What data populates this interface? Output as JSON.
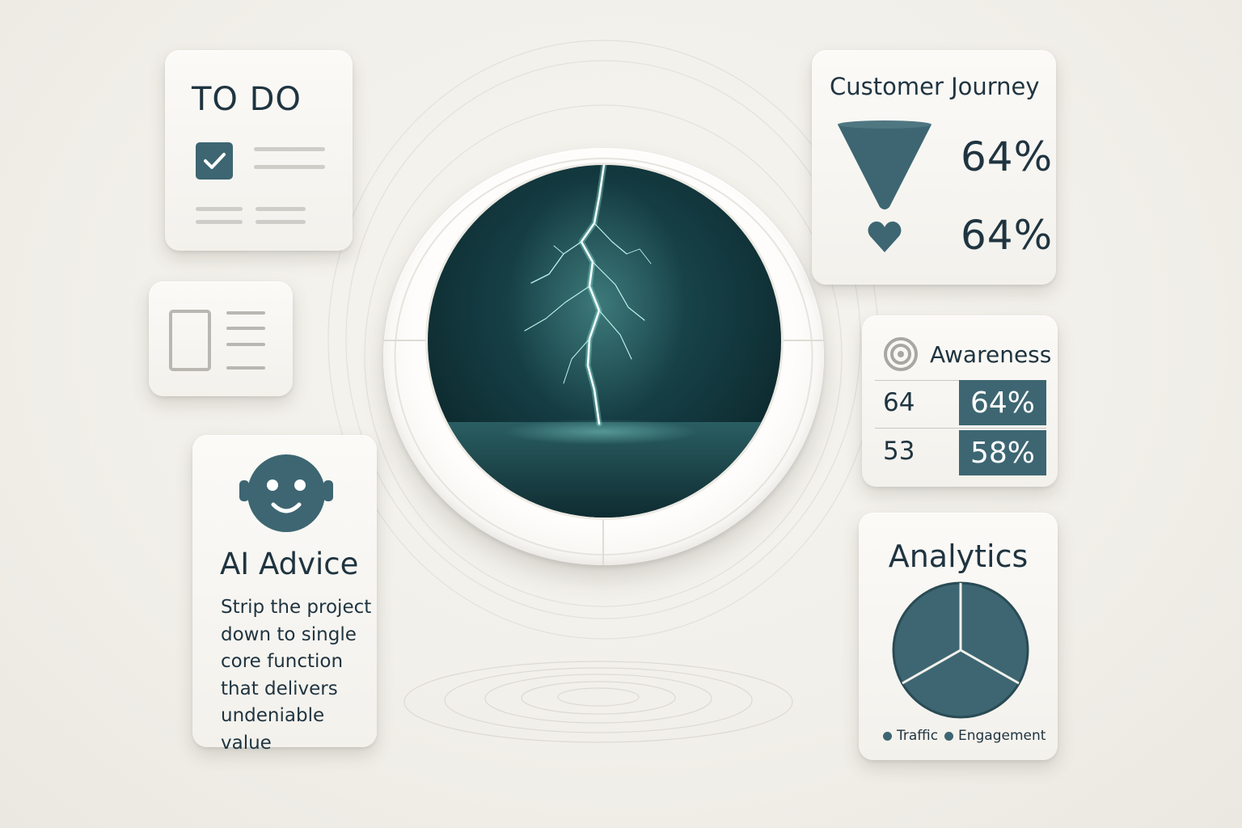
{
  "todo": {
    "title": "TO DO",
    "icons": {
      "checkbox": "checkbox-checked-icon"
    }
  },
  "layout_card": {
    "icon": "layout-list-icon"
  },
  "ai_advice": {
    "heading": "AI Advice",
    "avatar_icon": "robot-face-icon",
    "lines": [
      "Strip the project",
      "down to single",
      "core function",
      "that delivers",
      "undeniable value"
    ]
  },
  "center": {
    "image": "lightning-storm-over-sea"
  },
  "customer_journey": {
    "title": "Customer Journey",
    "funnel_value": "64%",
    "heart_value": "64%",
    "icons": {
      "funnel": "funnel-icon",
      "heart": "heart-icon"
    }
  },
  "awareness": {
    "title": "Awareness",
    "icon": "target-icon",
    "rows": [
      {
        "value": "64",
        "percent": "64%"
      },
      {
        "value": "53",
        "percent": "58%"
      }
    ]
  },
  "analytics": {
    "title": "Analytics",
    "legend": [
      "Traffic",
      "Engagement"
    ],
    "pie_icon": "pie-chart-icon"
  },
  "colors": {
    "accent": "#3d6672",
    "background": "#f2f0eb",
    "text": "#1f3440"
  }
}
